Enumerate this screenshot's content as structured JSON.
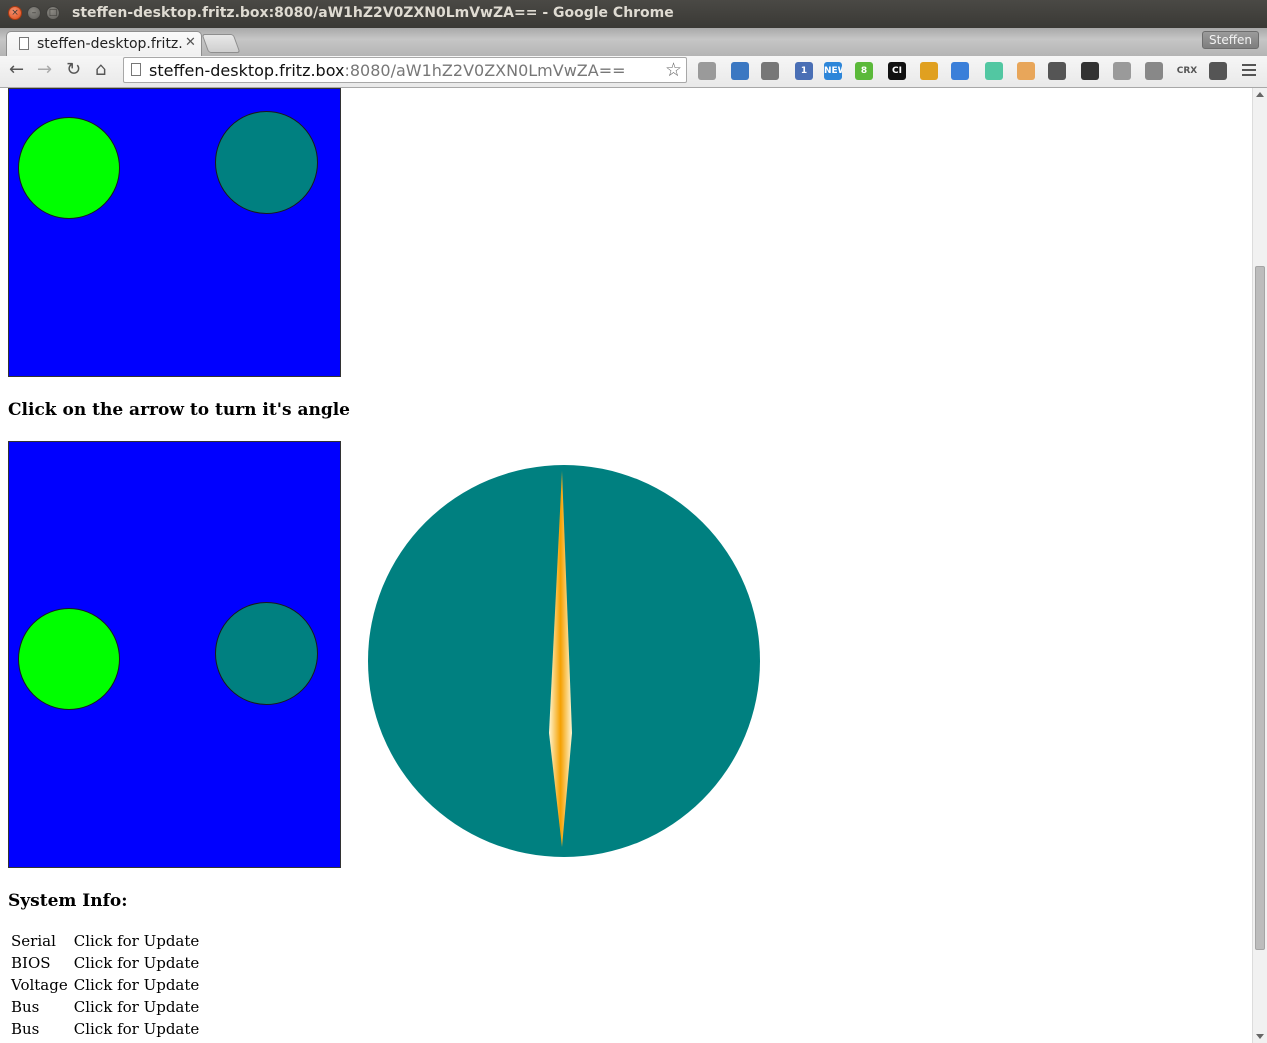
{
  "window": {
    "title": "steffen-desktop.fritz.box:8080/aW1hZ2V0ZXN0LmVwZA== - Google Chrome"
  },
  "tabs": [
    {
      "label": "steffen-desktop.fritz.box:8080/aW1hZ2V0ZXN0LmVwZA==",
      "icon": "page-icon",
      "active": true
    }
  ],
  "profile": {
    "label": "Steffen"
  },
  "toolbar": {
    "url_host": "steffen-desktop.fritz.box",
    "url_rest": ":8080/aW1hZ2V0ZXN0LmVwZA==",
    "extensions": [
      {
        "name": "bell-icon",
        "label": "",
        "color": "#9a9a9a"
      },
      {
        "name": "music-note-icon",
        "label": "",
        "color": "#3b78c2"
      },
      {
        "name": "cast-icon",
        "label": "",
        "color": "#777777"
      },
      {
        "name": "list-badge-icon",
        "label": "1",
        "color": "#4a6fb5"
      },
      {
        "name": "new-arrow-icon",
        "label": "NEW",
        "color": "#2d86d9"
      },
      {
        "name": "green-8-icon",
        "label": "8",
        "color": "#5bb93a"
      },
      {
        "name": "ci-icon",
        "label": "CI",
        "color": "#111111"
      },
      {
        "name": "donut-icon",
        "label": "",
        "color": "#e0a020"
      },
      {
        "name": "megaphone-icon",
        "label": "",
        "color": "#3a7fd9"
      },
      {
        "name": "waveform-icon",
        "label": "",
        "color": "#52c7a2"
      },
      {
        "name": "face-icon",
        "label": "",
        "color": "#e8a65a"
      },
      {
        "name": "dash-box-icon",
        "label": "",
        "color": "#555555"
      },
      {
        "name": "qr-code-icon",
        "label": "",
        "color": "#333333"
      },
      {
        "name": "puzzle-icon",
        "label": "",
        "color": "#9a9a9a"
      },
      {
        "name": "lock-icon",
        "label": "",
        "color": "#888888"
      },
      {
        "name": "crx-icon",
        "label": "CRX",
        "color": "#555555"
      },
      {
        "name": "shield-icon",
        "label": "",
        "color": "#555555"
      }
    ]
  },
  "page": {
    "circles_canvas": {
      "background": "#0000ff",
      "left_circle_color": "#00ff00",
      "right_circle_color": "#008080"
    },
    "arrow_heading": "Click on the arrow to turn it's angle",
    "dial": {
      "color": "#008080",
      "needle_color": "#f5a623"
    },
    "system_info_heading": "System Info:",
    "system_info": [
      {
        "key": "Serial",
        "value": "Click for Update"
      },
      {
        "key": "BIOS",
        "value": "Click for Update"
      },
      {
        "key": "Voltage",
        "value": "Click for Update"
      },
      {
        "key": "Bus",
        "value": "Click for Update"
      },
      {
        "key": "Bus",
        "value": "Click for Update"
      }
    ]
  }
}
